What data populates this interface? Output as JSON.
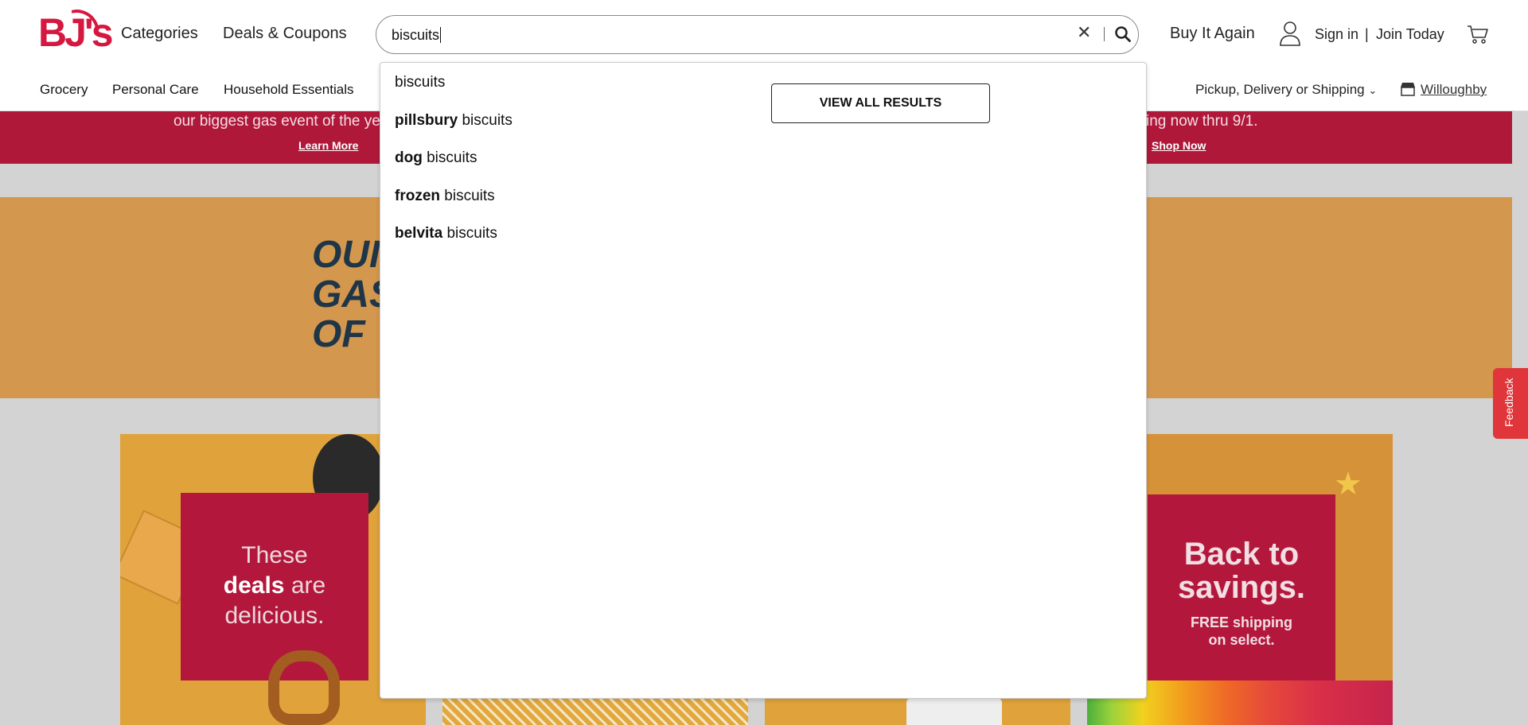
{
  "header": {
    "logo_text": "BJ's",
    "categories": "Categories",
    "deals": "Deals & Coupons",
    "search": {
      "value": "biscuits",
      "clear_icon": "close-icon",
      "submit_icon": "search-icon"
    },
    "buy_again": "Buy It Again",
    "sign_in": "Sign in",
    "separator": "|",
    "join": "Join Today",
    "cart_icon": "cart-icon"
  },
  "nav": {
    "items": [
      "Grocery",
      "Personal Care",
      "Household Essentials"
    ],
    "pickup": "Pickup, Delivery or Shipping",
    "store": "Willoughby"
  },
  "banner": {
    "left_text": "our biggest gas event of the ye",
    "left_link": "Learn More",
    "right_text": "ing now thru 9/1.",
    "right_link": "Shop Now",
    "color": "#b0183a"
  },
  "hero": {
    "lines": [
      "OUI",
      "GAS",
      "OF"
    ]
  },
  "tiles": {
    "deals": {
      "line1": "These",
      "bold": "deals",
      "rest": " are",
      "line3": "delicious."
    },
    "back": {
      "title1": "Back to",
      "title2": "savings.",
      "sub1": "FREE shipping",
      "sub2": "on select."
    }
  },
  "dropdown": {
    "suggestions": [
      {
        "bold": "",
        "rest": "biscuits"
      },
      {
        "bold": "pillsbury",
        "rest": " biscuits"
      },
      {
        "bold": "dog",
        "rest": " biscuits"
      },
      {
        "bold": "frozen",
        "rest": " biscuits"
      },
      {
        "bold": "belvita",
        "rest": " biscuits"
      }
    ],
    "view_all": "VIEW ALL RESULTS"
  },
  "feedback": "Feedback"
}
